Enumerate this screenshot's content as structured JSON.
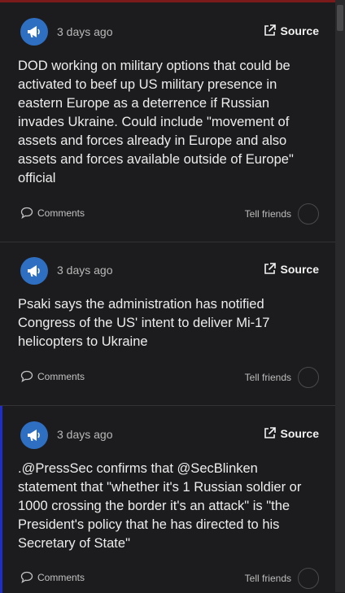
{
  "posts": [
    {
      "time": "3 days ago",
      "source_label": "Source",
      "text": "DOD working on military options that could be activated to beef up US military presence in eastern Europe as a deterrence if Russian invades Ukraine. Could include \"movement of assets and forces already in Europe and also assets and forces available outside of Europe\" official",
      "comments_label": "Comments",
      "share_label": "Tell friends"
    },
    {
      "time": "3 days ago",
      "source_label": "Source",
      "text": "Psaki says the administration has notified Congress of the US' intent to deliver Mi-17 helicopters to Ukraine",
      "comments_label": "Comments",
      "share_label": "Tell friends"
    },
    {
      "time": "3 days ago",
      "source_label": "Source",
      "text": ".@PressSec confirms that @SecBlinken statement that \"whether it's 1 Russian soldier or 1000 crossing the border it's an attack\" is \"the President's policy that he has directed to his Secretary of State\"",
      "comments_label": "Comments",
      "share_label": "Tell friends"
    }
  ],
  "colors": {
    "avatar": "#2f6fc2",
    "active_marker": "#1f2ec7",
    "background": "#1c1c1e"
  },
  "icons": [
    "megaphone-icon",
    "external-link-icon",
    "comment-bubble-icon",
    "share-circle-icon"
  ]
}
